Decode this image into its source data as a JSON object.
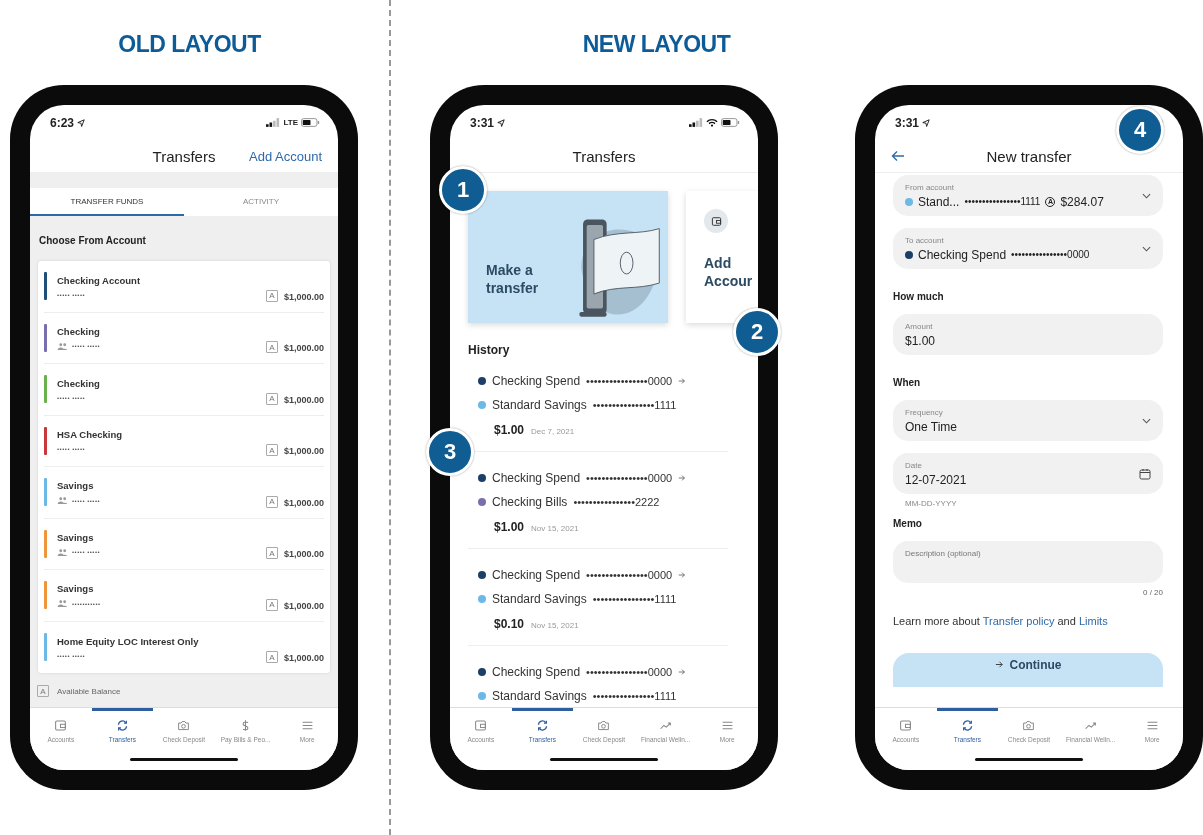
{
  "old_layout": {
    "heading": "OLD LAYOUT",
    "status_bar": {
      "time": "6:23",
      "network": "LTE"
    },
    "title": "Transfers",
    "header_action": "Add Account",
    "tabs": [
      {
        "label": "TRANSFER FUNDS",
        "selected": true
      },
      {
        "label": "ACTIVITY",
        "selected": false
      }
    ],
    "section_title": "Choose From Account",
    "accounts": [
      {
        "name": "Checking Account",
        "number": "••••• •••••",
        "shared": false,
        "balance_badge": "A",
        "balance": "$1,000.00",
        "color": "#1f4e79"
      },
      {
        "name": "Checking",
        "number": "••••• •••••",
        "shared": true,
        "balance_badge": "A",
        "balance": "$1,000.00",
        "color": "#7a6fae"
      },
      {
        "name": "Checking",
        "number": "••••• •••••",
        "shared": false,
        "balance_badge": "A",
        "balance": "$1,000.00",
        "color": "#6ab04c"
      },
      {
        "name": "HSA Checking",
        "number": "••••• •••••",
        "shared": false,
        "balance_badge": "A",
        "balance": "$1,000.00",
        "color": "#c8383a"
      },
      {
        "name": "Savings",
        "number": "••••• •••••",
        "shared": true,
        "balance_badge": "A",
        "balance": "$1,000.00",
        "color": "#6cb8e6"
      },
      {
        "name": "Savings",
        "number": "••••• •••••",
        "shared": true,
        "balance_badge": "A",
        "balance": "$1,000.00",
        "color": "#f0963a"
      },
      {
        "name": "Savings",
        "number": "•••••••••••",
        "shared": true,
        "balance_badge": "A",
        "balance": "$1,000.00",
        "color": "#f0963a"
      },
      {
        "name": "Home Equity LOC Interest Only",
        "number": "••••• •••••",
        "shared": false,
        "balance_badge": "A",
        "balance": "$1,000.00",
        "color": "#6cb8e6"
      }
    ],
    "legend": {
      "badge": "A",
      "label": "Available Balance"
    },
    "nav": [
      {
        "label": "Accounts",
        "selected": false
      },
      {
        "label": "Transfers",
        "selected": true
      },
      {
        "label": "Check Deposit",
        "selected": false
      },
      {
        "label": "Pay Bills & Peo...",
        "selected": false
      },
      {
        "label": "More",
        "selected": false
      }
    ]
  },
  "new_layout": {
    "heading": "NEW LAYOUT",
    "transfers_screen": {
      "status_bar": {
        "time": "3:31"
      },
      "title": "Transfers",
      "cards": [
        {
          "kind": "illustrated",
          "title": "Make a transfer"
        },
        {
          "kind": "icon",
          "title": "Add Accour"
        }
      ],
      "history_title": "History",
      "history": [
        {
          "from": {
            "name": "Checking Spend",
            "number": "••••••••••••••••0000",
            "color": "#1b3f66"
          },
          "to": {
            "name": "Standard Savings",
            "number": "••••••••••••••••1111",
            "color": "#6cb8e6"
          },
          "amount": "$1.00",
          "date": "Dec 7, 2021"
        },
        {
          "from": {
            "name": "Checking Spend",
            "number": "••••••••••••••••0000",
            "color": "#1b3f66"
          },
          "to": {
            "name": "Checking Bills",
            "number": "••••••••••••••••2222",
            "color": "#7a6fae"
          },
          "amount": "$1.00",
          "date": "Nov 15, 2021"
        },
        {
          "from": {
            "name": "Checking Spend",
            "number": "••••••••••••••••0000",
            "color": "#1b3f66"
          },
          "to": {
            "name": "Standard Savings",
            "number": "••••••••••••••••1111",
            "color": "#6cb8e6"
          },
          "amount": "$0.10",
          "date": "Nov 15, 2021"
        },
        {
          "from": {
            "name": "Checking Spend",
            "number": "••••••••••••••••0000",
            "color": "#1b3f66"
          },
          "to": {
            "name": "Standard Savings",
            "number": "••••••••••••••••1111",
            "color": "#6cb8e6"
          }
        }
      ],
      "nav": [
        {
          "label": "Accounts",
          "selected": false
        },
        {
          "label": "Transfers",
          "selected": true
        },
        {
          "label": "Check Deposit",
          "selected": false
        },
        {
          "label": "Financial Welln...",
          "selected": false
        },
        {
          "label": "More",
          "selected": false
        }
      ]
    },
    "new_transfer_screen": {
      "status_bar": {
        "time": "3:31"
      },
      "title": "New transfer",
      "from_account": {
        "label": "From account",
        "name": "Stand...",
        "number": "••••••••••••••••1111",
        "balance_badge": "A",
        "balance": "$284.07",
        "color": "#6cb8e6"
      },
      "to_account": {
        "label": "To account",
        "name": "Checking Spend",
        "number": "••••••••••••••••0000",
        "color": "#1b3f66"
      },
      "amount_section": "How much",
      "amount": {
        "label": "Amount",
        "value": "$1.00"
      },
      "when_section": "When",
      "frequency": {
        "label": "Frequency",
        "value": "One Time"
      },
      "date": {
        "label": "Date",
        "value": "12-07-2021",
        "hint": "MM-DD-YYYY"
      },
      "memo_section": "Memo",
      "memo": {
        "placeholder": "Description (optional)",
        "counter": "0 / 20"
      },
      "footer_note": {
        "prefix": "Learn more about",
        "link_1": "Transfer policy",
        "joiner": "and",
        "link_2": "Limits"
      },
      "continue_label": "Continue",
      "nav": [
        {
          "label": "Accounts",
          "selected": false
        },
        {
          "label": "Transfers",
          "selected": true
        },
        {
          "label": "Check Deposit",
          "selected": false
        },
        {
          "label": "Financial Welln...",
          "selected": false
        },
        {
          "label": "More",
          "selected": false
        }
      ]
    }
  },
  "callouts": [
    "1",
    "2",
    "3",
    "4"
  ]
}
